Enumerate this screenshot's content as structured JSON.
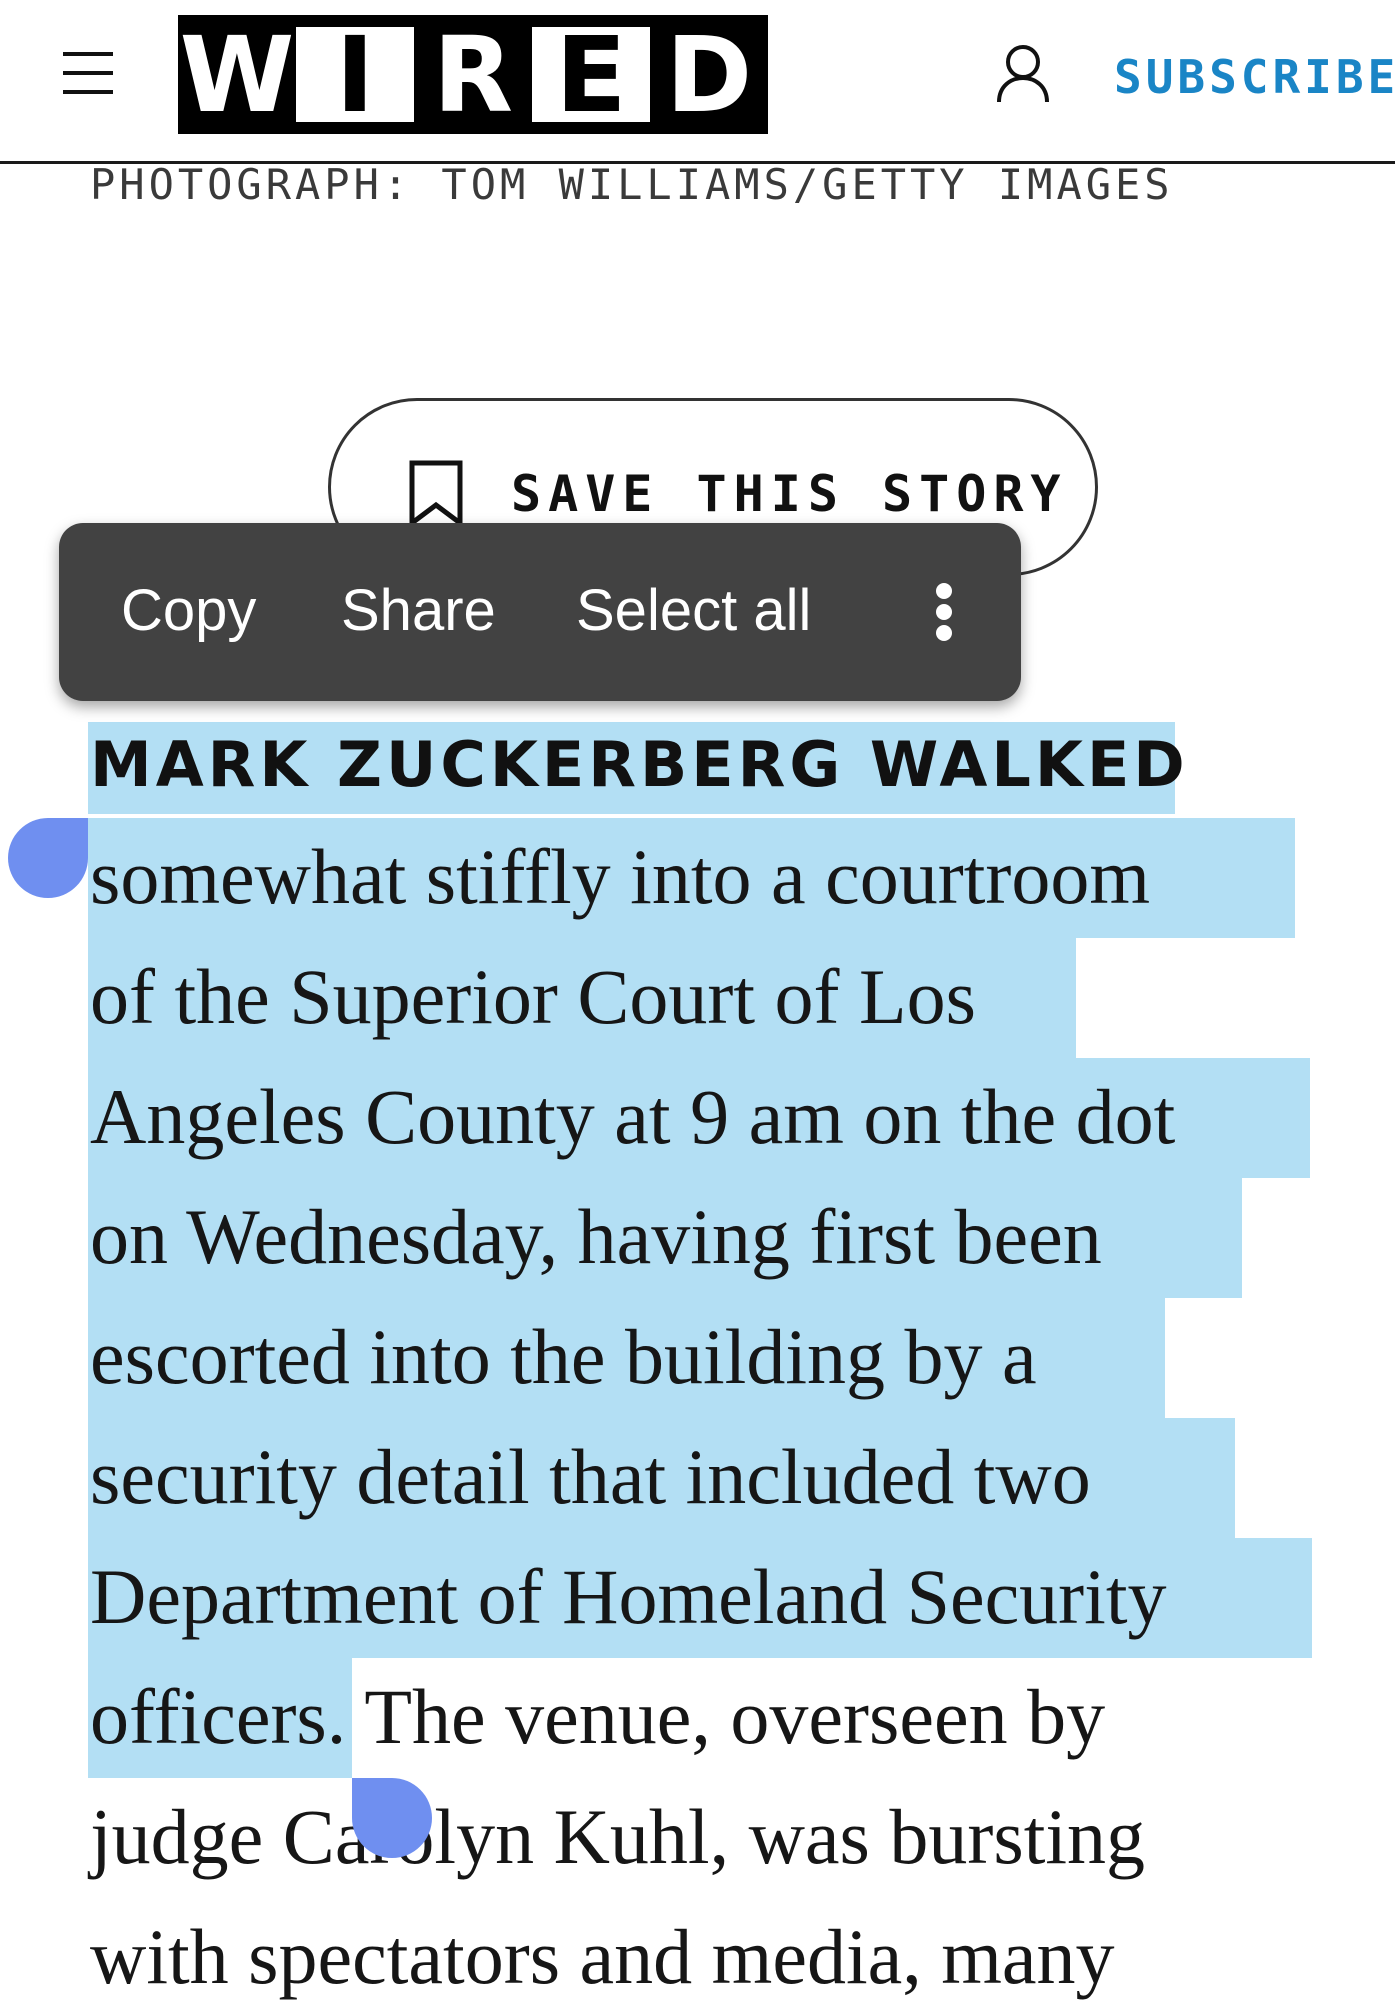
{
  "header": {
    "logo_letters": [
      "W",
      "I",
      "R",
      "E",
      "D"
    ],
    "subscribe_label": "SUBSCRIBE",
    "menu_icon": "hamburger-menu-icon",
    "account_icon": "person-icon"
  },
  "photo_credit": "PHOTOGRAPH: TOM WILLIAMS/GETTY IMAGES",
  "save_story": {
    "label": "SAVE THIS STORY",
    "icon": "bookmark-icon"
  },
  "context_menu": {
    "copy": "Copy",
    "share": "Share",
    "select_all": "Select all",
    "more_icon": "more-vertical-icon"
  },
  "article": {
    "lead": "MARK ZUCKERBERG WALKED",
    "lines": [
      "somewhat stiffly into a courtroom",
      "of the Superior Court of Los",
      "Angeles County at 9 am on the dot",
      "on Wednesday, having first been",
      "escorted into the building by a",
      "security detail that included two",
      "Department of Homeland Security",
      "officers",
      ". The venue, overseen by",
      "judge Carolyn Kuhl, was bursting",
      "with spectators and media, many"
    ]
  },
  "colors": {
    "subscribe": "#1a85c6",
    "selection": "#b3dff4",
    "selection_handle": "#6f8ff0",
    "toolbar": "#424242"
  }
}
